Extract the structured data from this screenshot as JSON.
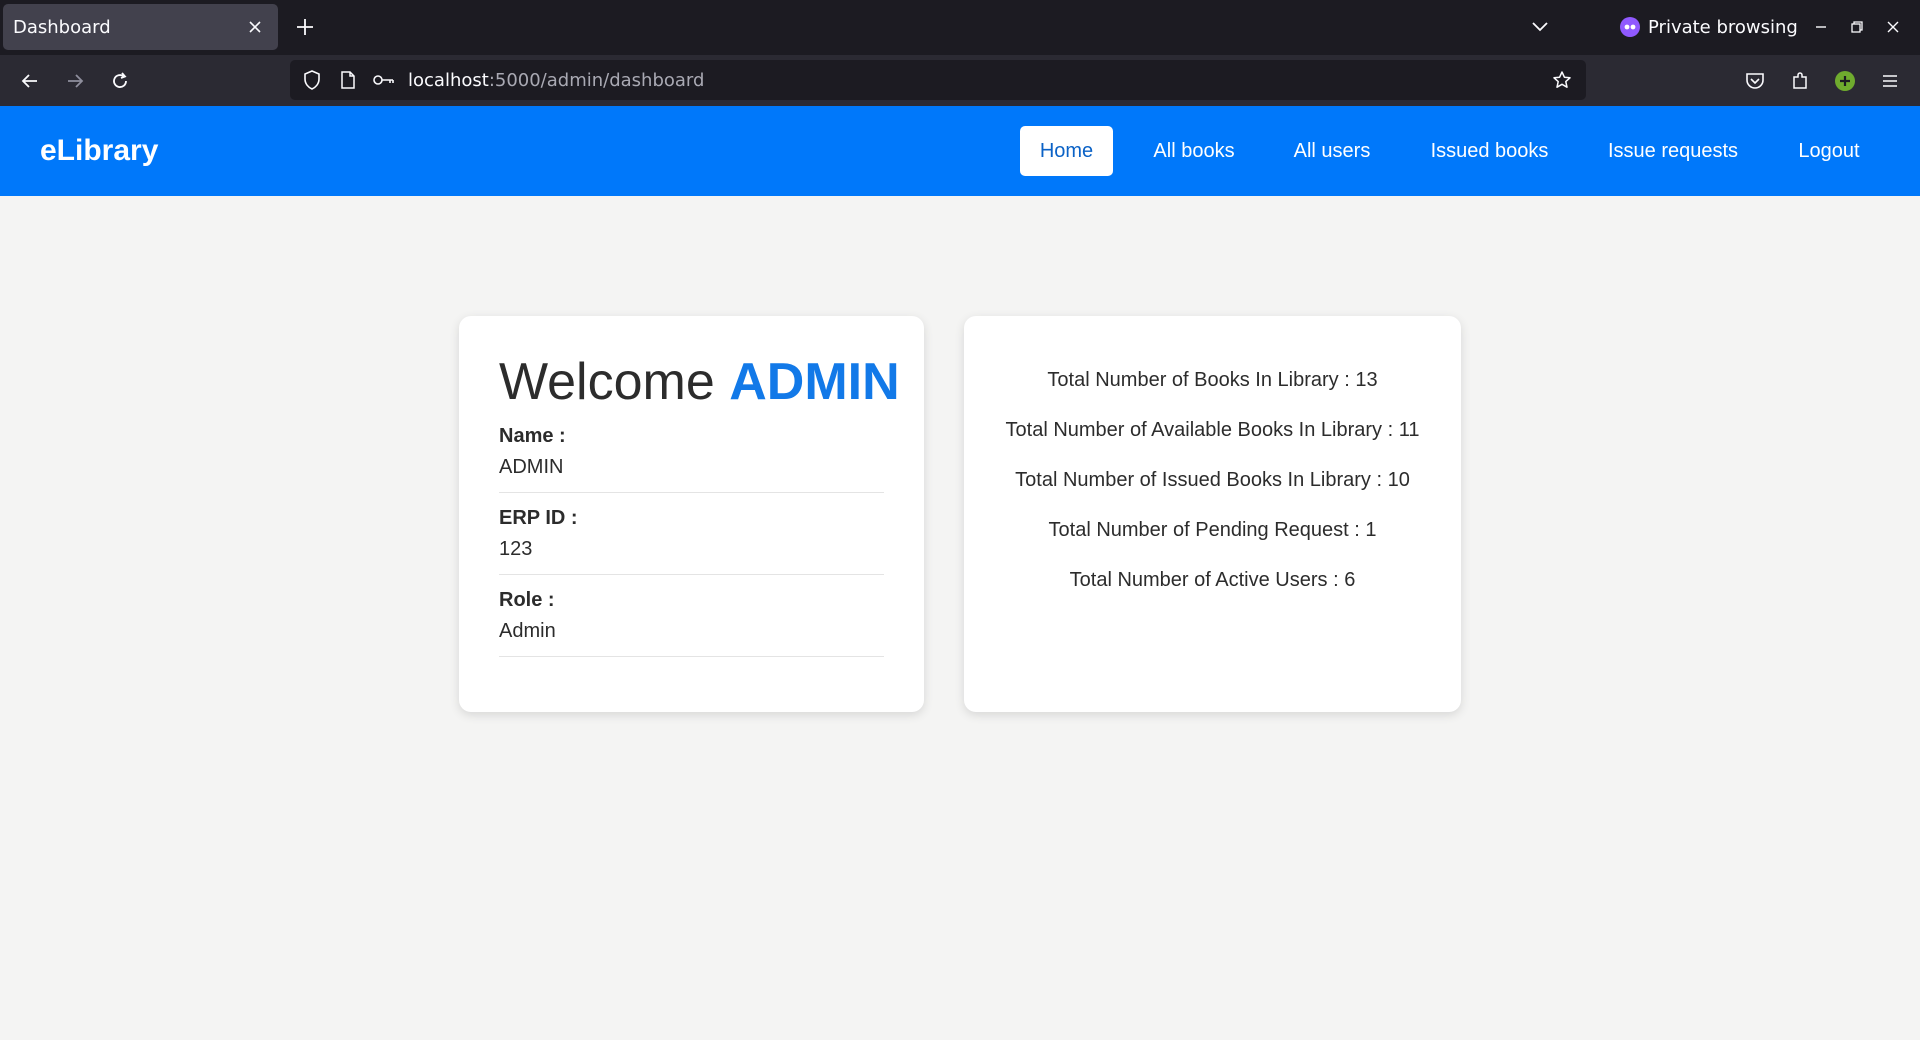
{
  "browser": {
    "tab_title": "Dashboard",
    "private_label": "Private browsing",
    "url_host": "localhost",
    "url_path": ":5000/admin/dashboard",
    "icons": [
      "close-icon",
      "plus-icon",
      "chevron-down-icon",
      "mask-icon",
      "minimize-icon",
      "restore-icon",
      "close-window-icon",
      "back-icon",
      "forward-icon",
      "reload-icon",
      "shield-icon",
      "page-icon",
      "key-icon",
      "star-icon",
      "pocket-icon",
      "extensions-icon",
      "addon-icon",
      "menu-icon"
    ]
  },
  "app": {
    "brand": "eLibrary",
    "nav": [
      {
        "label": "Home",
        "active": true
      },
      {
        "label": "All books",
        "active": false
      },
      {
        "label": "All users",
        "active": false
      },
      {
        "label": "Issued books",
        "active": false
      },
      {
        "label": "Issue requests",
        "active": false
      },
      {
        "label": "Logout",
        "active": false
      }
    ],
    "accent_color": "#0078fa"
  },
  "profile": {
    "welcome_prefix": "Welcome",
    "welcome_name": "ADMIN",
    "fields": [
      {
        "label": "Name :",
        "value": "ADMIN"
      },
      {
        "label": "ERP ID :",
        "value": "123"
      },
      {
        "label": "Role :",
        "value": "Admin"
      }
    ]
  },
  "stats": [
    "Total Number of Books In Library : 13",
    "Total Number of Available Books In Library : 11",
    "Total Number of Issued Books In Library : 10",
    "Total Number of Pending Request : 1",
    "Total Number of Active Users : 6"
  ]
}
